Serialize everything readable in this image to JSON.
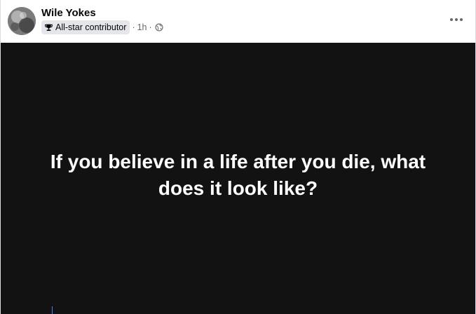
{
  "post": {
    "author": {
      "name": "Wile Yokes",
      "avatar_icon": "avatar-photo"
    },
    "badge": {
      "icon": "trophy-icon",
      "label": "All-star contributor"
    },
    "separator": "·",
    "timestamp": "1h",
    "audience_icon": "globe-icon",
    "more_icon": "more-horizontal-icon",
    "media": {
      "background_color": "#121212",
      "text": "If you believe in a life after you die, what does it look like?"
    }
  }
}
